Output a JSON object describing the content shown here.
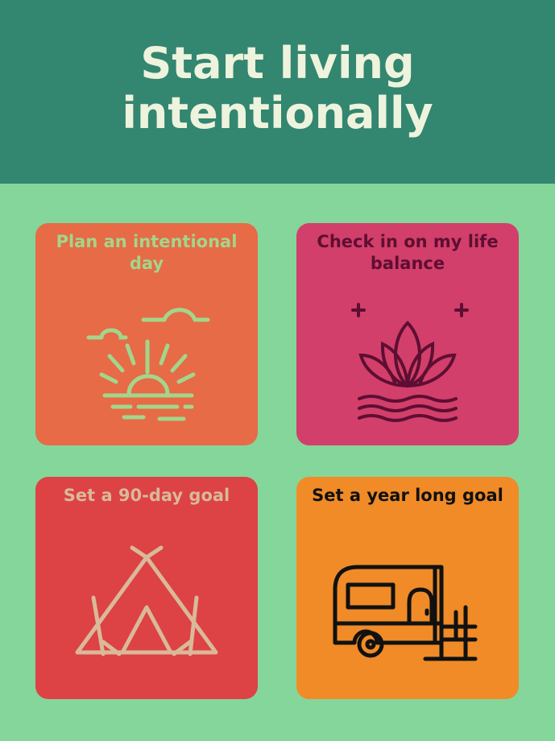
{
  "header": {
    "title_line1": "Start living",
    "title_line2": "intentionally"
  },
  "colors": {
    "header_bg": "#338670",
    "page_bg": "#84d69b",
    "title_text": "#eef3dd"
  },
  "cards": [
    {
      "label": "Plan an intentional day",
      "icon": "sunset-icon",
      "bg": "#e66b46",
      "text_color": "#a4d58a"
    },
    {
      "label": "Check in on my life balance",
      "icon": "lotus-icon",
      "bg": "#d23f6a",
      "text_color": "#5e0e33"
    },
    {
      "label": "Set a 90-day goal",
      "icon": "tent-icon",
      "bg": "#dd4245",
      "text_color": "#d9b999"
    },
    {
      "label": "Set a year long goal",
      "icon": "camper-trailer-icon",
      "bg": "#f08b27",
      "text_color": "#111111"
    }
  ]
}
